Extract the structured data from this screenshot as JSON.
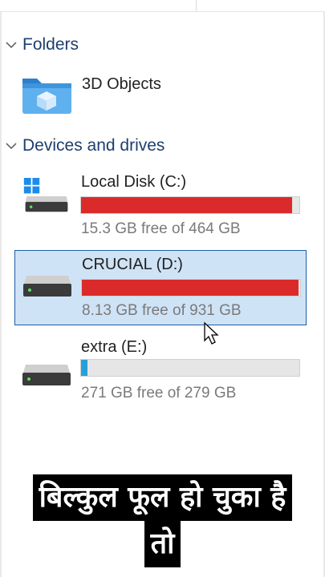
{
  "sections": {
    "folders": {
      "label": "Folders"
    },
    "devices": {
      "label": "Devices and drives"
    }
  },
  "folders": [
    {
      "label": "3D Objects",
      "icon": "3d-objects-folder-icon"
    }
  ],
  "drives": [
    {
      "name": "Local Disk (C:)",
      "free_text": "15.3 GB free of 464 GB",
      "used_fraction": 0.967,
      "bar_color": "#da2a2a",
      "icon": "windows-drive-icon",
      "selected": false
    },
    {
      "name": "CRUCIAL (D:)",
      "free_text": "8.13 GB free of 931 GB",
      "used_fraction": 0.991,
      "bar_color": "#da2a2a",
      "icon": "hard-drive-icon",
      "selected": true
    },
    {
      "name": "extra (E:)",
      "free_text": "271 GB free of 279 GB",
      "used_fraction": 0.029,
      "bar_color": "#26a0da",
      "icon": "hard-drive-icon",
      "selected": false
    }
  ],
  "caption": {
    "line1": "बिल्कुल फूल हो चुका है",
    "line2": "तो"
  },
  "colors": {
    "section_header": "#1d3f6e",
    "selection_bg": "#cfe3f6",
    "selection_border": "#1b5fa3",
    "full_bar": "#da2a2a",
    "normal_bar": "#26a0da"
  }
}
